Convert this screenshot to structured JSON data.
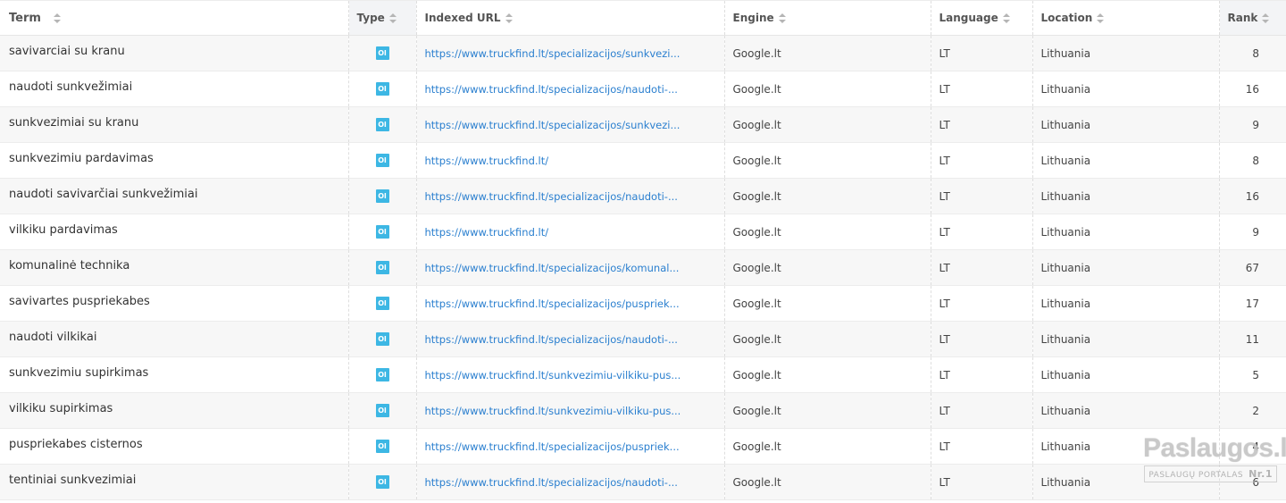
{
  "headers": {
    "term": "Term",
    "type": "Type",
    "url": "Indexed URL",
    "engine": "Engine",
    "language": "Language",
    "location": "Location",
    "rank": "Rank"
  },
  "type_icon_label": "Ol",
  "rows": [
    {
      "term": "savivarciai su kranu",
      "url": "https://www.truckfind.lt/specializacijos/sunkvezi...",
      "engine": "Google.lt",
      "language": "LT",
      "location": "Lithuania",
      "rank": "8"
    },
    {
      "term": "naudoti sunkvežimiai",
      "url": "https://www.truckfind.lt/specializacijos/naudoti-...",
      "engine": "Google.lt",
      "language": "LT",
      "location": "Lithuania",
      "rank": "16"
    },
    {
      "term": "sunkvezimiai su kranu",
      "url": "https://www.truckfind.lt/specializacijos/sunkvezi...",
      "engine": "Google.lt",
      "language": "LT",
      "location": "Lithuania",
      "rank": "9"
    },
    {
      "term": "sunkvezimiu pardavimas",
      "url": "https://www.truckfind.lt/",
      "engine": "Google.lt",
      "language": "LT",
      "location": "Lithuania",
      "rank": "8"
    },
    {
      "term": "naudoti savivarčiai sunkvežimiai",
      "url": "https://www.truckfind.lt/specializacijos/naudoti-...",
      "engine": "Google.lt",
      "language": "LT",
      "location": "Lithuania",
      "rank": "16"
    },
    {
      "term": "vilkiku pardavimas",
      "url": "https://www.truckfind.lt/",
      "engine": "Google.lt",
      "language": "LT",
      "location": "Lithuania",
      "rank": "9"
    },
    {
      "term": "komunalinė technika",
      "url": "https://www.truckfind.lt/specializacijos/komunal...",
      "engine": "Google.lt",
      "language": "LT",
      "location": "Lithuania",
      "rank": "67"
    },
    {
      "term": "savivartes puspriekabes",
      "url": "https://www.truckfind.lt/specializacijos/puspriek...",
      "engine": "Google.lt",
      "language": "LT",
      "location": "Lithuania",
      "rank": "17"
    },
    {
      "term": "naudoti vilkikai",
      "url": "https://www.truckfind.lt/specializacijos/naudoti-...",
      "engine": "Google.lt",
      "language": "LT",
      "location": "Lithuania",
      "rank": "11"
    },
    {
      "term": "sunkvezimiu supirkimas",
      "url": "https://www.truckfind.lt/sunkvezimiu-vilkiku-pus...",
      "engine": "Google.lt",
      "language": "LT",
      "location": "Lithuania",
      "rank": "5"
    },
    {
      "term": "vilkiku supirkimas",
      "url": "https://www.truckfind.lt/sunkvezimiu-vilkiku-pus...",
      "engine": "Google.lt",
      "language": "LT",
      "location": "Lithuania",
      "rank": "2"
    },
    {
      "term": "puspriekabes cisternos",
      "url": "https://www.truckfind.lt/specializacijos/puspriek...",
      "engine": "Google.lt",
      "language": "LT",
      "location": "Lithuania",
      "rank": "4"
    },
    {
      "term": "tentiniai sunkvezimiai",
      "url": "https://www.truckfind.lt/specializacijos/naudoti-...",
      "engine": "Google.lt",
      "language": "LT",
      "location": "Lithuania",
      "rank": "6"
    }
  ],
  "watermark": {
    "main": "Paslaugos.lt",
    "sub": "PASLAUGŲ PORTALAS",
    "badge": "Nr.1"
  },
  "colors": {
    "link": "#2a7fcf",
    "type_icon": "#3db7e4",
    "row_alt": "#f7f7f7"
  }
}
